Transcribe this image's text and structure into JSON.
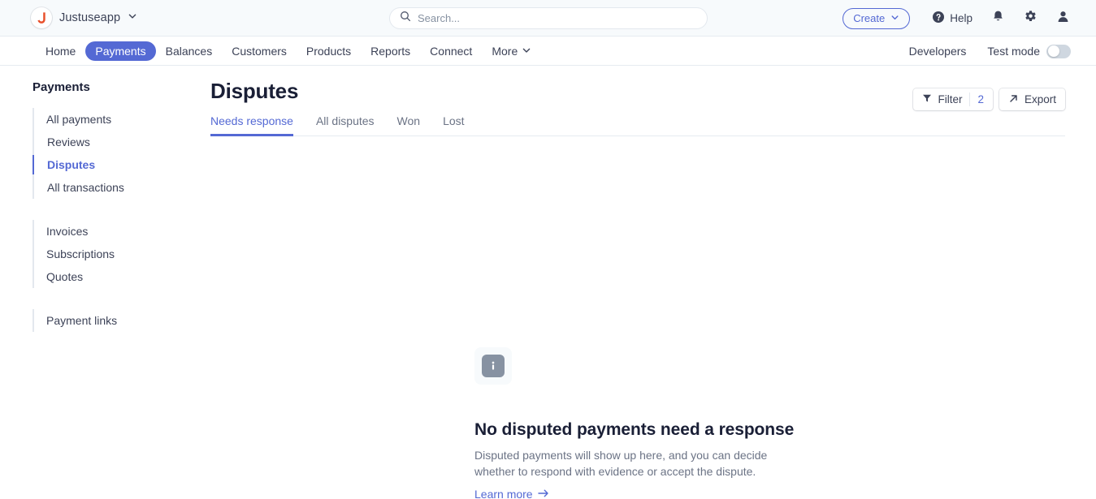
{
  "topbar": {
    "brand_name": "Justuseapp",
    "brand_initial": "J",
    "brand_chevron": "chevron-down-icon",
    "search": {
      "placeholder": "Search...",
      "value": "",
      "icon": "search-icon"
    },
    "create_label": "Create",
    "create_chevron": "chevron-down-icon",
    "help_label": "Help",
    "help_icon": "help-circle-icon",
    "notifications_icon": "bell-icon",
    "settings_icon": "gear-icon",
    "account_icon": "user-icon"
  },
  "nav": {
    "items": [
      {
        "label": "Home",
        "active": false
      },
      {
        "label": "Payments",
        "active": true
      },
      {
        "label": "Balances",
        "active": false
      },
      {
        "label": "Customers",
        "active": false
      },
      {
        "label": "Products",
        "active": false
      },
      {
        "label": "Reports",
        "active": false
      },
      {
        "label": "Connect",
        "active": false
      },
      {
        "label": "More",
        "active": false
      }
    ],
    "more_chevron": "chevron-down-icon",
    "developers_label": "Developers",
    "test_mode_label": "Test mode",
    "test_mode_on": false
  },
  "sidebar": {
    "title": "Payments",
    "items": [
      {
        "label": "All payments",
        "active": false,
        "level": 1
      },
      {
        "label": "Reviews",
        "active": false,
        "level": 2
      },
      {
        "label": "Disputes",
        "active": true,
        "level": 2
      },
      {
        "label": "All transactions",
        "active": false,
        "level": 2
      }
    ],
    "items2": [
      {
        "label": "Invoices",
        "active": false
      },
      {
        "label": "Subscriptions",
        "active": false
      },
      {
        "label": "Quotes",
        "active": false
      }
    ],
    "items3": [
      {
        "label": "Payment links",
        "active": false
      }
    ]
  },
  "page": {
    "title": "Disputes",
    "filter_label": "Filter",
    "filter_count": "2",
    "filter_icon": "funnel-icon",
    "export_label": "Export",
    "export_icon": "arrow-up-right-icon",
    "tabs": [
      {
        "label": "Needs response",
        "active": true
      },
      {
        "label": "All disputes",
        "active": false
      },
      {
        "label": "Won",
        "active": false
      },
      {
        "label": "Lost",
        "active": false
      }
    ]
  },
  "empty_state": {
    "icon": "info-icon",
    "title": "No disputed payments need a response",
    "description": "Disputed payments will show up here, and you can decide whether to respond with evidence or accept the dispute.",
    "link_label": "Learn more",
    "link_arrow": "arrow-right-icon"
  },
  "colors": {
    "accent": "#5469d4",
    "text_dark": "#1a1f36",
    "text_muted": "#6b7385",
    "brand_logo": "#e8512c",
    "icon_gray": "#8792a2"
  }
}
